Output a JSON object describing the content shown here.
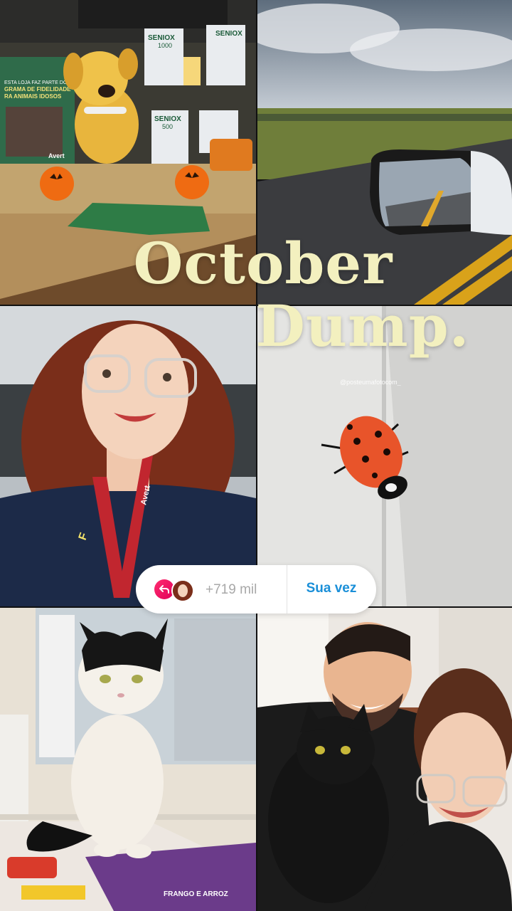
{
  "story": {
    "title_line1": "October",
    "title_line2": "Dump.",
    "watermark": "@posteumafotocom_"
  },
  "reply": {
    "count": "+719 mil",
    "button_label": "Sua vez",
    "accent_color": "#ff2d6f",
    "button_color": "#1a8fd8"
  },
  "photos": {
    "shop": {
      "product1": "SENIOX",
      "product1_dose": "1000",
      "product2": "SENIOX",
      "product2_dose": "500",
      "poster_line1": "ESTA LOJA FAZ PARTE DO",
      "poster_line2": "GRAMA DE FIDELIDADE",
      "poster_line3": "RA ANIMAIS IDOSOS",
      "brand": "Avert"
    },
    "selfie": {
      "lanyard_text": "Avert"
    },
    "cat": {
      "bag_text": "FRANGO E ARROZ"
    }
  }
}
